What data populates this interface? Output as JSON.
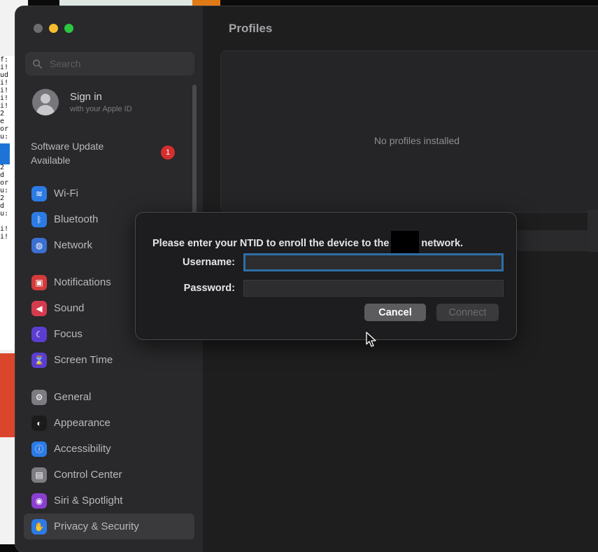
{
  "window": {
    "title": "Profiles"
  },
  "search": {
    "placeholder": "Search"
  },
  "account": {
    "title": "Sign in",
    "subtitle": "with your Apple ID"
  },
  "update": {
    "label": "Software Update Available",
    "badge": "1"
  },
  "sidebar": {
    "group1": [
      {
        "label": "Wi-Fi",
        "icon": "wifi-icon",
        "color": "#2c7be5",
        "glyph": "≋"
      },
      {
        "label": "Bluetooth",
        "icon": "bluetooth-icon",
        "color": "#2c7be5",
        "glyph": "ᛒ"
      },
      {
        "label": "Network",
        "icon": "network-icon",
        "color": "#3b6fd1",
        "glyph": "◍"
      }
    ],
    "group2": [
      {
        "label": "Notifications",
        "icon": "notifications-icon",
        "color": "#d53b3b",
        "glyph": "▣"
      },
      {
        "label": "Sound",
        "icon": "sound-icon",
        "color": "#d53b4e",
        "glyph": "◀"
      },
      {
        "label": "Focus",
        "icon": "focus-icon",
        "color": "#5b3ed0",
        "glyph": "☾"
      },
      {
        "label": "Screen Time",
        "icon": "screen-time-icon",
        "color": "#5b3ed0",
        "glyph": "⌛"
      }
    ],
    "group3": [
      {
        "label": "General",
        "icon": "general-icon",
        "color": "#7d7c80",
        "glyph": "⚙"
      },
      {
        "label": "Appearance",
        "icon": "appearance-icon",
        "color": "#1b1b1c",
        "glyph": "◐"
      },
      {
        "label": "Accessibility",
        "icon": "accessibility-icon",
        "color": "#2c7be5",
        "glyph": "ⓘ"
      },
      {
        "label": "Control Center",
        "icon": "control-center-icon",
        "color": "#7d7c80",
        "glyph": "▤"
      },
      {
        "label": "Siri & Spotlight",
        "icon": "siri-icon",
        "color": "#8a3fd0",
        "glyph": "◉"
      },
      {
        "label": "Privacy & Security",
        "icon": "privacy-hand-icon",
        "color": "#2c7be5",
        "glyph": "✋"
      }
    ]
  },
  "main": {
    "empty_text": "No profiles installed"
  },
  "dialog": {
    "message_before": "Please enter your NTID to enroll the device to the",
    "message_after": "network.",
    "username_label": "Username:",
    "username_value": "",
    "password_label": "Password:",
    "password_value": "",
    "cancel_label": "Cancel",
    "connect_label": "Connect"
  },
  "background": {
    "terminal_text": "f:\ni!\nud\ni!\ni!\ni!\ni!\n2\ne\nor\nu:\n\ni!\ni!\n2\nd\nor\nu:\n2\nd\nu:\n\ni!\ni!"
  }
}
